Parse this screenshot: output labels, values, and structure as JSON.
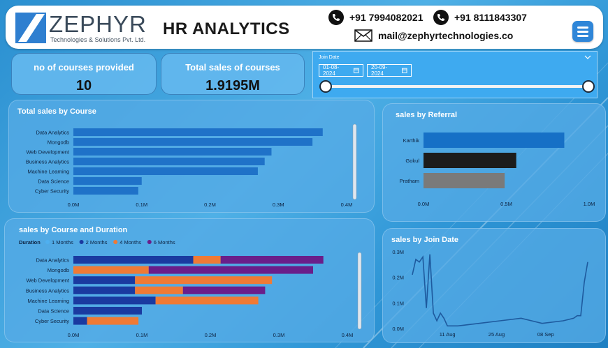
{
  "header": {
    "logo_name": "ZEPHYR",
    "logo_sub": "Technologies & Solutions Pvt. Ltd.",
    "title": "HR ANALYTICS",
    "phone1": "+91 7994082021",
    "phone2": "+91 8111843307",
    "email": "mail@zephyrtechnologies.co"
  },
  "kpis": [
    {
      "label": "no of courses provided",
      "value": "10"
    },
    {
      "label": "Total sales of courses",
      "value": "1.9195M"
    }
  ],
  "slicer": {
    "title": "Join Date",
    "start": "01-08-2024",
    "end": "20-09-2024"
  },
  "charts": {
    "sales_by_course": {
      "title": "Total sales by Course"
    },
    "sales_by_referral": {
      "title": "sales by Referral"
    },
    "sales_by_course_duration": {
      "title": "sales by Course and Duration",
      "legend_title": "Duration"
    },
    "sales_by_join_date": {
      "title": "sales by Join Date"
    }
  },
  "colors": {
    "bar_blue": "#1f72c8",
    "karthik": "#1670c6",
    "gokul": "#1c1c1c",
    "pratham": "#7a7a7a",
    "d1": "#4fb0f0",
    "d2": "#1a3aa0",
    "d4": "#ef7a35",
    "d6": "#6a1e8a",
    "line": "#1e5a9e"
  },
  "chart_data": [
    {
      "type": "bar",
      "title": "Total sales by Course",
      "orientation": "horizontal",
      "categories": [
        "Data Analytics",
        "Mongodb",
        "Web Development",
        "Business Analytics",
        "Machine Learning",
        "Data Science",
        "Cyber Security"
      ],
      "values": [
        0.365,
        0.35,
        0.29,
        0.28,
        0.27,
        0.1,
        0.095
      ],
      "xticks": [
        "0.0M",
        "0.1M",
        "0.2M",
        "0.3M",
        "0.4M"
      ],
      "xlim": [
        0,
        0.4
      ],
      "unit": "M"
    },
    {
      "type": "bar",
      "title": "sales by Referral",
      "orientation": "horizontal",
      "categories": [
        "Karthik",
        "Gokul",
        "Pratham"
      ],
      "values": [
        0.85,
        0.56,
        0.49
      ],
      "xticks": [
        "0.0M",
        "0.5M",
        "1.0M"
      ],
      "xlim": [
        0,
        1.0
      ],
      "unit": "M"
    },
    {
      "type": "bar",
      "title": "sales by Course and Duration",
      "orientation": "horizontal",
      "stacked": true,
      "legend_title": "Duration",
      "categories": [
        "Data Analytics",
        "Mongodb",
        "Web Development",
        "Business Analytics",
        "Machine Learning",
        "Data Science",
        "Cyber Security"
      ],
      "series": [
        {
          "name": "1 Months",
          "values": [
            0,
            0,
            0,
            0,
            0,
            0,
            0
          ]
        },
        {
          "name": "2 Months",
          "values": [
            0.175,
            0,
            0.09,
            0.09,
            0.12,
            0.1,
            0.02
          ]
        },
        {
          "name": "4 Months",
          "values": [
            0.04,
            0.11,
            0.2,
            0.07,
            0.15,
            0,
            0.075
          ]
        },
        {
          "name": "6 Months",
          "values": [
            0.15,
            0.24,
            0,
            0.12,
            0,
            0,
            0
          ]
        }
      ],
      "xticks": [
        "0.0M",
        "0.1M",
        "0.2M",
        "0.3M",
        "0.4M"
      ],
      "xlim": [
        0,
        0.4
      ],
      "unit": "M"
    },
    {
      "type": "line",
      "title": "sales by Join Date",
      "xticks": [
        "11 Aug",
        "25 Aug",
        "08 Sep"
      ],
      "yticks": [
        "0.0M",
        "0.1M",
        "0.2M",
        "0.3M"
      ],
      "ylim": [
        0,
        0.3
      ],
      "x": [
        "2024-08-01",
        "2024-08-02",
        "2024-08-03",
        "2024-08-04",
        "2024-08-05",
        "2024-08-06",
        "2024-08-07",
        "2024-08-08",
        "2024-08-09",
        "2024-08-10",
        "2024-08-11",
        "2024-08-14",
        "2024-08-20",
        "2024-08-26",
        "2024-09-01",
        "2024-09-07",
        "2024-09-13",
        "2024-09-16",
        "2024-09-17",
        "2024-09-18",
        "2024-09-19",
        "2024-09-20"
      ],
      "y": [
        0.21,
        0.27,
        0.26,
        0.28,
        0.08,
        0.29,
        0.06,
        0.03,
        0.06,
        0.04,
        0.01,
        0.01,
        0.02,
        0.03,
        0.04,
        0.02,
        0.03,
        0.04,
        0.05,
        0.05,
        0.18,
        0.26
      ]
    }
  ]
}
